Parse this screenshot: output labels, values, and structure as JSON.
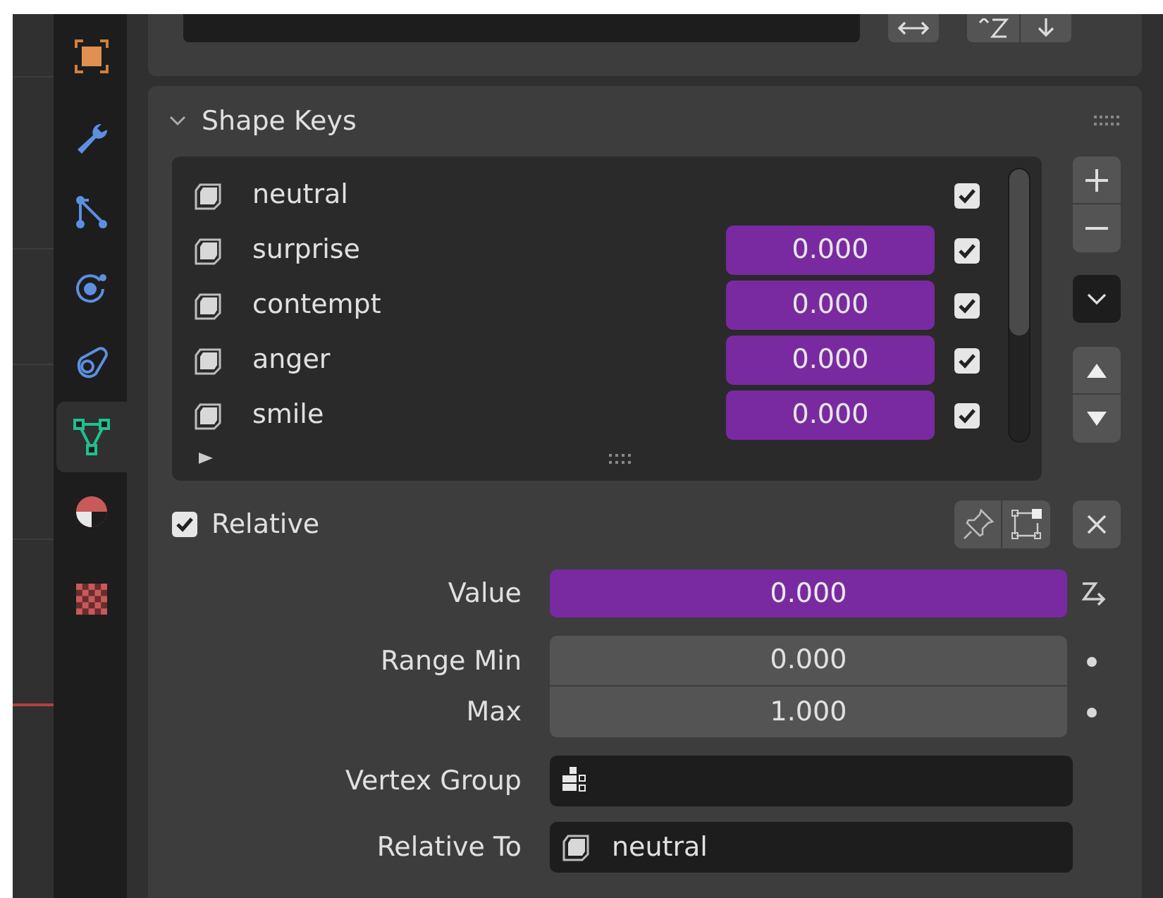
{
  "sidebar": {
    "tabs": [
      {
        "kind": "object",
        "selected": false
      },
      {
        "kind": "modifiers",
        "selected": false
      },
      {
        "kind": "particles",
        "selected": false
      },
      {
        "kind": "physics",
        "selected": false
      },
      {
        "kind": "constraints",
        "selected": false
      },
      {
        "kind": "data",
        "selected": true
      },
      {
        "kind": "material",
        "selected": false
      },
      {
        "kind": "texture",
        "selected": false
      }
    ]
  },
  "panel": {
    "title": "Shape Keys",
    "expanded": true,
    "keys": [
      {
        "name": "neutral",
        "checked": true
      },
      {
        "name": "surprise",
        "value": "0.000",
        "checked": true
      },
      {
        "name": "contempt",
        "value": "0.000",
        "checked": true
      },
      {
        "name": "anger",
        "value": "0.000",
        "checked": true
      },
      {
        "name": "smile",
        "value": "0.000",
        "checked": true
      }
    ],
    "relative": {
      "label": "Relative",
      "checked": true
    },
    "properties": [
      {
        "kind": "slider",
        "label": "Value",
        "value": "0.000"
      },
      {
        "kind": "number",
        "label": "Range Min",
        "value": "0.000"
      },
      {
        "kind": "number",
        "label": "Max",
        "value": "1.000"
      },
      {
        "kind": "vertex-group",
        "label": "Vertex Group"
      },
      {
        "kind": "key-select",
        "label": "Relative To",
        "value": "neutral"
      }
    ]
  }
}
